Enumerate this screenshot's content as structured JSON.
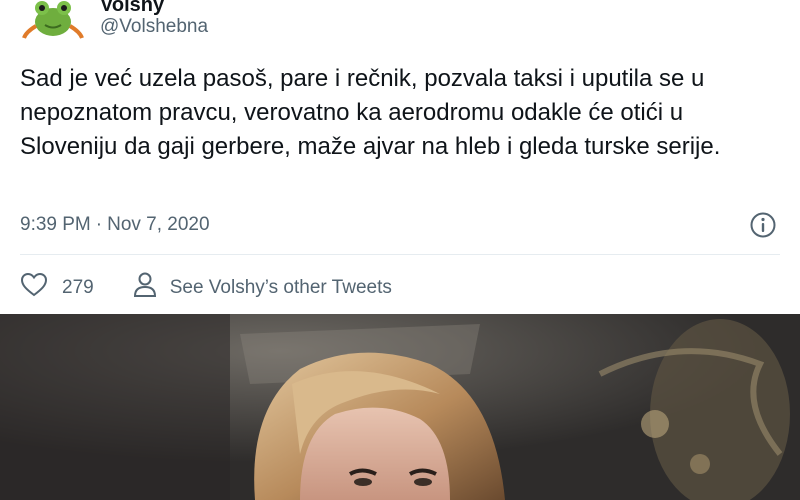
{
  "tweet": {
    "author": {
      "name": "Volshy",
      "handle": "@Volshebna",
      "avatar_icon": "frog-avatar-icon"
    },
    "text": "Sad je već uzela pasoš, pare i rečnik, pozvala taksi i uputila se u nepoznatom pravcu, verovatno ka aerodromu odakle će otići u Sloveniju da gaji gerbere, maže ajvar na hleb i gleda turske serije.",
    "time": "9:39 PM",
    "separator": "·",
    "date": "Nov 7, 2020",
    "likes": "279",
    "other_tweets_label": "See Volshy’s other Tweets",
    "icons": {
      "info": "info-icon",
      "like": "heart-icon",
      "profile": "person-icon"
    }
  },
  "colors": {
    "text_primary": "#0f1419",
    "text_secondary": "#536471",
    "border": "#cfd9de"
  },
  "photo": {
    "alt": "photo-of-woman"
  }
}
